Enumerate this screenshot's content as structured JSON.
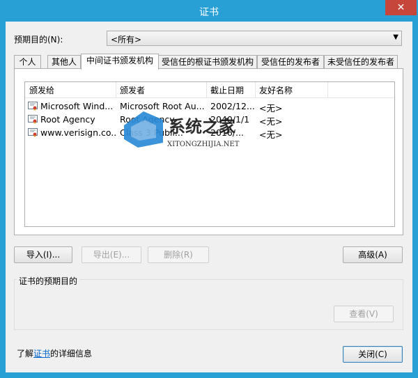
{
  "window": {
    "title": "证书",
    "close_glyph": "✕"
  },
  "purpose": {
    "label": "预期目的(N):",
    "selected": "<所有>"
  },
  "tabs": [
    {
      "label": "个人"
    },
    {
      "label": "其他人"
    },
    {
      "label": "中间证书颁发机构",
      "active": true
    },
    {
      "label": "受信任的根证书颁发机构"
    },
    {
      "label": "受信任的发布者"
    },
    {
      "label": "未受信任的发布者"
    }
  ],
  "list": {
    "columns": [
      "颁发给",
      "颁发者",
      "截止日期",
      "友好名称"
    ],
    "rows": [
      {
        "issued_to": "Microsoft Wind...",
        "issuer": "Microsoft Root Au...",
        "expires": "2002/12...",
        "friendly": "<无>"
      },
      {
        "issued_to": "Root Agency",
        "issuer": "Root Agency",
        "expires": "2040/1/1",
        "friendly": "<无>"
      },
      {
        "issued_to": "www.verisign.co...",
        "issuer": "Class 3 Publi...",
        "expires": "2016/...",
        "friendly": "<无>"
      }
    ]
  },
  "buttons": {
    "import": "导入(I)...",
    "export": "导出(E)...",
    "remove": "删除(R)",
    "advanced": "高级(A)",
    "view": "查看(V)",
    "close": "关闭(C)"
  },
  "group": {
    "label": "证书的预期目的"
  },
  "learn": {
    "prefix": "了解",
    "link": "证书",
    "suffix": "的详细信息"
  },
  "watermark": {
    "text_cn": "系统之家",
    "text_en": "XITONGZHIJIA.NET"
  },
  "colors": {
    "titlebar": "#28a0d6",
    "close": "#c7463b",
    "link": "#0066cc"
  }
}
